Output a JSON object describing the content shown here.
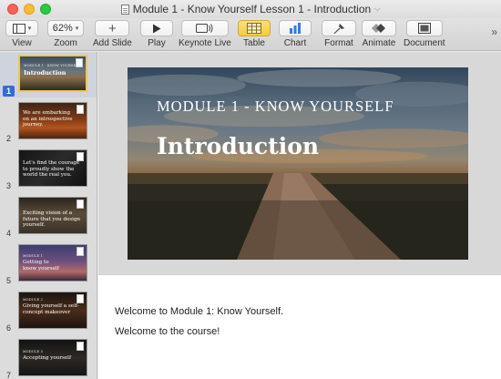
{
  "window": {
    "title": "Module 1 - Know Yourself Lesson 1 - Introduction",
    "colors": {
      "close": "#fc5f57",
      "minimize": "#fdbc2e",
      "zoom": "#29c940",
      "selection": "#f1c84c",
      "table_button": "#f7d44d"
    }
  },
  "toolbar": {
    "view": {
      "label": "View"
    },
    "zoom": {
      "label": "Zoom",
      "value": "62%"
    },
    "add_slide": {
      "label": "Add Slide",
      "glyph": "+"
    },
    "play": {
      "label": "Play"
    },
    "keynote_live": {
      "label": "Keynote Live"
    },
    "table": {
      "label": "Table"
    },
    "chart": {
      "label": "Chart"
    },
    "format": {
      "label": "Format"
    },
    "animate": {
      "label": "Animate"
    },
    "document": {
      "label": "Document"
    },
    "more": "»"
  },
  "sidebar": {
    "slides": [
      {
        "number": "1",
        "sub": "MODULE 1 - KNOW YOURSELF",
        "text": "Introduction",
        "selected": true
      },
      {
        "number": "2",
        "text": "We are embarking on an introspective journey."
      },
      {
        "number": "3",
        "text": "Let's find the courage to proudly show the world the real you."
      },
      {
        "number": "4",
        "text": "Exciting vision of a future that you design yourself."
      },
      {
        "number": "5",
        "sub": "MODULE 1",
        "text": "Getting to know yourself"
      },
      {
        "number": "6",
        "sub": "MODULE 2",
        "text": "Giving yourself a self-concept makeover"
      },
      {
        "number": "7",
        "sub": "MODULE 3",
        "text": "Accepting yourself"
      }
    ]
  },
  "slide": {
    "kicker": "MODULE 1 - KNOW YOURSELF",
    "title": "Introduction"
  },
  "notes": {
    "line1": "Welcome to Module 1: Know Yourself.",
    "line2": "Welcome to the course!"
  }
}
